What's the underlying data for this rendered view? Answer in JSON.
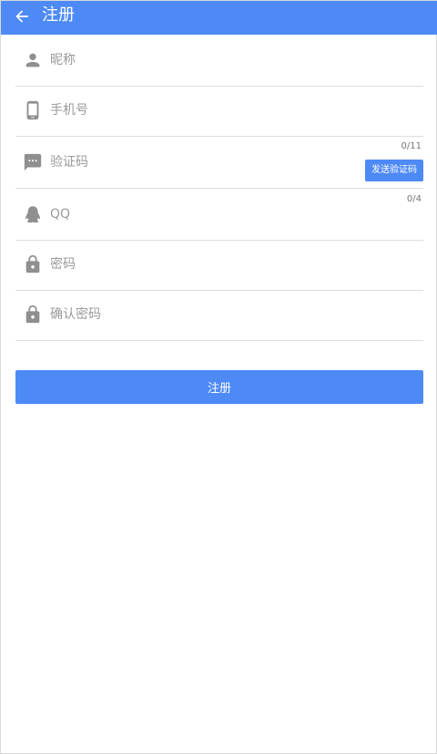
{
  "header": {
    "title": "注册",
    "back_icon": "arrow-left-icon"
  },
  "form": {
    "nickname": {
      "placeholder": "昵称",
      "value": "",
      "icon": "person-icon"
    },
    "phone": {
      "placeholder": "手机号",
      "value": "",
      "icon": "phone-icon",
      "counter": "0/11"
    },
    "code": {
      "placeholder": "验证码",
      "value": "",
      "icon": "message-icon",
      "counter": "0/4",
      "send_label": "发送验证码"
    },
    "qq": {
      "placeholder": "QQ",
      "value": "",
      "icon": "qq-penguin-icon"
    },
    "password": {
      "placeholder": "密码",
      "value": "",
      "icon": "lock-icon"
    },
    "confirm_password": {
      "placeholder": "确认密码",
      "value": "",
      "icon": "lock-icon"
    }
  },
  "submit_label": "注册",
  "colors": {
    "accent": "#4e8af6",
    "icon": "#8f8f8f",
    "divider": "#dddddd"
  }
}
